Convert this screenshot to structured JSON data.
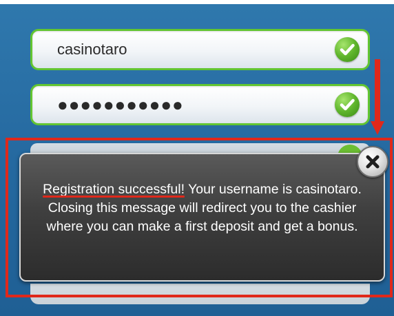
{
  "form": {
    "username_value": "casinotaro",
    "password_value": "●●●●●●●●●●●",
    "valid_icon": "check-circle-icon",
    "valid_color": "#5fb52c"
  },
  "modal": {
    "message_highlight": "Registration successful!",
    "message_rest": " Your username is casinotaro. Closing this message will redirect you to the cashier where you can make a first deposit and get a bonus.",
    "close_icon": "close-icon"
  },
  "annotation": {
    "color": "#e0281a"
  }
}
